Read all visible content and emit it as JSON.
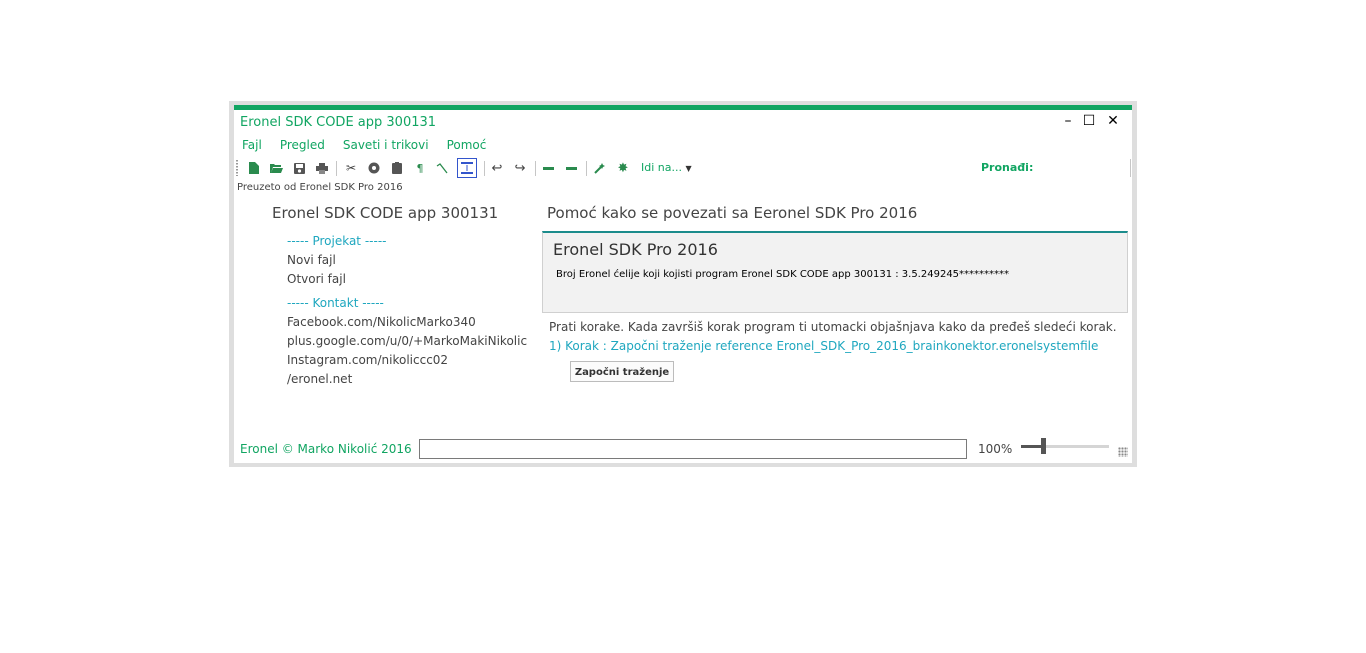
{
  "window": {
    "title": "Eronel SDK CODE app 300131",
    "controls": {
      "minimize": "–",
      "maximize": "☐",
      "close": "✕"
    }
  },
  "menu": [
    "Fajl",
    "Pregled",
    "Saveti i trikovi",
    "Pomoć"
  ],
  "toolbar": {
    "icons": [
      "new-file-icon",
      "open-folder-icon",
      "save-icon",
      "print-icon",
      "cut-icon",
      "record-icon",
      "paste-icon",
      "paragraph-icon",
      "line-tool-icon",
      "code-block-icon",
      "undo-icon",
      "redo-icon",
      "minus-icon",
      "minus-icon",
      "magic-brush-icon",
      "star-icon"
    ],
    "goto_label": "Idi na...",
    "find_label": "Pronađi:"
  },
  "source_note": "Preuzeto od Eronel SDK Pro 2016",
  "left_panel": {
    "title": "Eronel SDK CODE app 300131",
    "projects_header": "----- Projekat -----",
    "projects": [
      "Novi fajl",
      "Otvori fajl"
    ],
    "contacts_header": "----- Kontakt -----",
    "contacts": [
      "Facebook.com/NikolicMarko340",
      "plus.google.com/u/0/+MarkoMakiNikolic",
      "Instagram.com/nikoliccc02",
      "/eronel.net"
    ]
  },
  "right_panel": {
    "title": "Pomoć kako se povezati sa Eeronel SDK Pro 2016",
    "box_title": "Eronel SDK Pro 2016",
    "box_text": "Broj Eronel ćelije koji kojisti program Eronel SDK CODE app 300131 : 3.5.249245**********",
    "instruction": "Prati korake. Kada završiš korak program ti utomacki objašnjava kako da pređeš sledeći korak.",
    "step": "1) Korak : Započni traženje reference Eronel_SDK_Pro_2016_brainkonektor.eronelsystemfile",
    "start_button": "Započni traženje"
  },
  "status_bar": {
    "copyright": "Eronel © Marko Nikolić 2016",
    "input_value": "",
    "zoom_label": "100%",
    "zoom_fraction": 0.25
  },
  "colors": {
    "accent": "#11a562",
    "link": "#1fa7bf",
    "box_border": "#1b8c8c"
  }
}
